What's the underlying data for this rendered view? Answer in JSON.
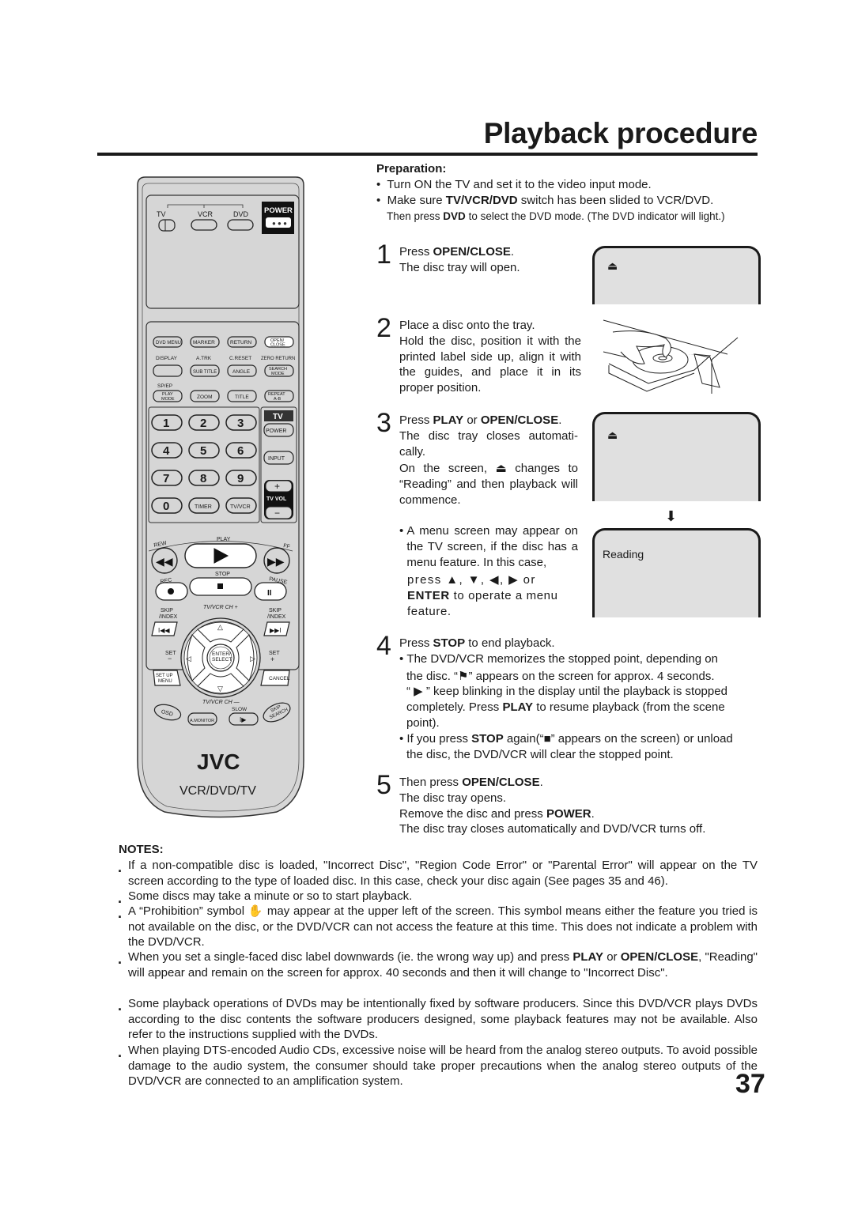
{
  "page": {
    "title": "Playback procedure",
    "page_number": "37"
  },
  "remote": {
    "switch_labels": [
      "TV",
      "VCR",
      "DVD"
    ],
    "power": "POWER",
    "row1": [
      "DVD MENU",
      "MARKER",
      "RETURN",
      "OPEN/",
      "CLOSE"
    ],
    "row2_labels": [
      "DISPLAY",
      "A.TRK",
      "C.RESET",
      "ZERO RETURN"
    ],
    "row2_buttons": [
      "",
      "SUB TITLE",
      "ANGLE",
      "SEARCH",
      "MODE"
    ],
    "row3_label": "SP/EP",
    "row3_buttons": [
      "PLAY",
      "MODE",
      "ZOOM",
      "TITLE",
      "REPEAT",
      "A-B"
    ],
    "digits": [
      "1",
      "2",
      "3",
      "4",
      "5",
      "6",
      "7",
      "8",
      "9",
      "0"
    ],
    "timer": "TIMER",
    "tvvcr": "TV/VCR",
    "tv_header": "TV",
    "tv_power": "POWER",
    "tv_input": "INPUT",
    "tv_vol": "TV VOL",
    "plus": "+",
    "minus": "−",
    "play": "PLAY",
    "rew": "REW",
    "ff": "FF",
    "rec": "REC",
    "stop": "STOP",
    "pause": "PAUSE",
    "skip_index": [
      "SKIP",
      "/INDEX"
    ],
    "ch_up": "TV/VCR CH +",
    "ch_down": "TV/VCR CH —",
    "set_minus": [
      "SET",
      "−"
    ],
    "set_plus": [
      "SET",
      "+"
    ],
    "enter": [
      "ENTER/",
      "SELECT"
    ],
    "setup_menu": [
      "SET UP",
      "MENU"
    ],
    "cancel": "CANCEL",
    "osd": "OSD",
    "amonitor": "A.MONITOR",
    "slow": "SLOW",
    "skip_search": [
      "SKIP",
      "SEARCH"
    ],
    "brand": "JVC",
    "model": "VCR/DVD/TV"
  },
  "preparation": {
    "heading": "Preparation:",
    "bullet1": "Turn ON the TV and set it to the video input mode.",
    "bullet2_pre": "Make sure ",
    "bullet2_bold": "TV/VCR/DVD",
    "bullet2_post": " switch has been slided to VCR/DVD.",
    "bullet2_line2_pre": "Then press ",
    "bullet2_line2_bold": "DVD",
    "bullet2_line2_post": " to select the DVD mode. (The DVD indicator will light.)"
  },
  "steps": [
    {
      "num": "1",
      "l1_pre": "Press ",
      "l1_bold": "OPEN/CLOSE",
      "l1_post": ".",
      "l2": "The disc tray will open."
    },
    {
      "num": "2",
      "l1": "Place a disc onto the tray.",
      "body": "Hold the disc, position it with the printed label side up, align it with the guides, and place it in its proper position."
    },
    {
      "num": "3",
      "l1_pre": "Press ",
      "l1_bold1": "PLAY",
      "l1_mid": " or ",
      "l1_bold2": "OPEN/CLOSE",
      "l1_post": ".",
      "body1": "The disc tray closes automati-cally.",
      "body2_pre": "On the screen, ",
      "body2_post": " changes to “Reading” and then playback will commence.",
      "note_pre": "A menu screen may appear on the TV screen, if the disc has a menu feature. In this case,",
      "note_press": "press ▲, ▼, ◀, ▶ or",
      "note_enter": "ENTER",
      "note_post": " to operate a menu feature."
    },
    {
      "num": "4",
      "l1_pre": "Press ",
      "l1_bold": "STOP",
      "l1_post": " to end playback.",
      "b1_l1": "The DVD/VCR memorizes the stopped point, depending on",
      "b1_l2": "the disc. “⚑” appears on the screen for approx. 4 seconds.",
      "b1_l3": "“ ▶ ” keep blinking in the display until the playback is stopped",
      "b1_l4_pre": "completely. Press ",
      "b1_l4_bold": "PLAY",
      "b1_l4_post": " to resume playback (from the scene",
      "b1_l5": "point).",
      "b2_pre": "If you press ",
      "b2_bold": "STOP",
      "b2_post": " again(“■” appears on the screen) or unload",
      "b2_l2": "the disc, the DVD/VCR will clear the stopped point."
    },
    {
      "num": "5",
      "l1_pre": "Then press ",
      "l1_bold": "OPEN/CLOSE",
      "l1_post": ".",
      "l2": "The disc tray opens.",
      "l3_pre": "Remove the disc and press ",
      "l3_bold": "POWER",
      "l3_post": ".",
      "l4": "The disc tray closes automatically and DVD/VCR turns off."
    }
  ],
  "screens": {
    "eject_symbol": "⏏",
    "reading": "Reading"
  },
  "notes": {
    "heading": "NOTES:",
    "items": [
      "If a non-compatible disc is loaded, \"Incorrect Disc\", \"Region Code Error\" or \"Parental Error\" will appear on the TV screen according to the type of loaded disc. In this case, check your disc again (See pages 35 and 46).",
      "Some discs may take a minute or so to start playback.",
      "A “Prohibition” symbol ✋ may appear at the upper left of the screen. This symbol means either the feature you tried is not available on the disc, or the DVD/VCR can not access the feature at this time. This does not indicate a problem with the DVD/VCR.",
      "Some playback operations of DVDs may be intentionally fixed by software producers. Since this DVD/VCR plays DVDs according to the disc contents the software producers designed, some playback features may not be available. Also refer to the instructions supplied with the DVDs.",
      "When playing DTS-encoded Audio CDs, excessive noise will be heard from the analog stereo outputs. To avoid possible damage to the audio system, the consumer should take proper precautions when the analog stereo outputs of the DVD/VCR are connected to an amplification system."
    ],
    "item4_pre": "When you set a single-faced disc label downwards (ie. the wrong way up) and press ",
    "item4_bold1": "PLAY",
    "item4_mid": " or ",
    "item4_bold2": "OPEN/CLOSE",
    "item4_post": ", \"Reading\" will appear and remain on the screen for approx. 40 seconds and then it will change to \"Incorrect Disc\"."
  }
}
